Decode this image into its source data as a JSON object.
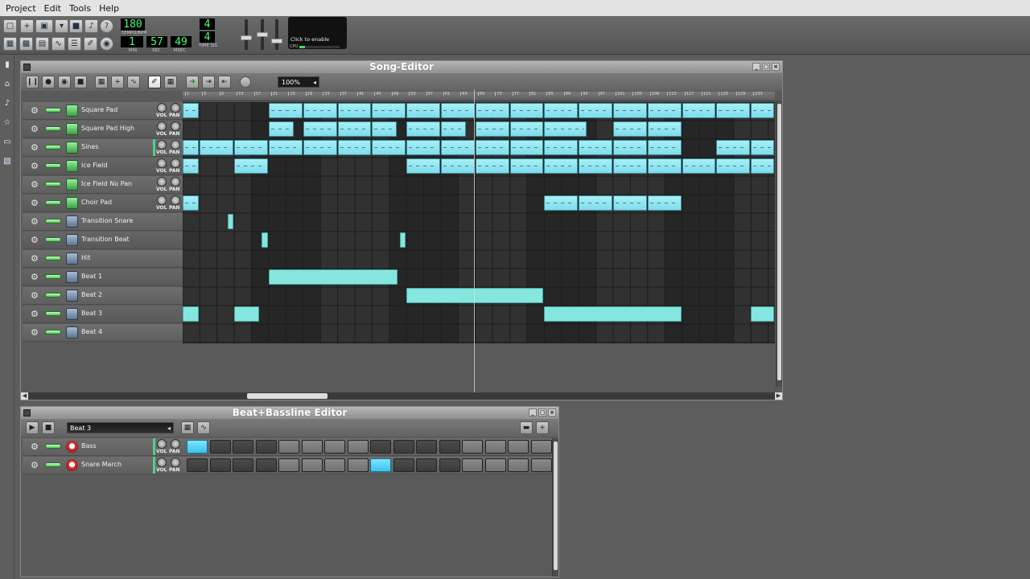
{
  "menu": [
    "Project",
    "Edit",
    "Tools",
    "Help"
  ],
  "transport": {
    "tempo": "180",
    "tempo_label": "TEMPO/BPM",
    "time_min": "1",
    "time_sec": "57",
    "time_msec": "49",
    "min_label": "MIN",
    "sec_label": "SEC",
    "msec_label": "MSEC",
    "timesig_num": "4",
    "timesig_den": "4",
    "timesig_label": "TIME SIG"
  },
  "cpu": {
    "hint": "Click to enable",
    "label": "CPU",
    "usage": 0.14
  },
  "song_editor": {
    "title": "Song-Editor",
    "zoom": "100%",
    "ruler": [
      "1",
      "5",
      "9",
      "13",
      "17",
      "21",
      "25",
      "29",
      "33",
      "37",
      "41",
      "45",
      "49",
      "53",
      "57",
      "61",
      "65",
      "69",
      "73",
      "77",
      "81",
      "85",
      "89",
      "93",
      "97",
      "101",
      "105",
      "109",
      "113",
      "117",
      "121",
      "125",
      "129",
      "133"
    ],
    "tracks": [
      {
        "name": "Square Pad",
        "type": "synth"
      },
      {
        "name": "Square Pad High",
        "type": "synth"
      },
      {
        "name": "Sines",
        "type": "synth"
      },
      {
        "name": "Ice Field",
        "type": "synth"
      },
      {
        "name": "Ice Field No Pan",
        "type": "synth"
      },
      {
        "name": "Choir Pad",
        "type": "synth"
      },
      {
        "name": "Transition Snare",
        "type": "bb"
      },
      {
        "name": "Transition Beat",
        "type": "bb"
      },
      {
        "name": "Hit",
        "type": "bb"
      },
      {
        "name": "Beat 1",
        "type": "bb"
      },
      {
        "name": "Beat 2",
        "type": "bb"
      },
      {
        "name": "Beat 3",
        "type": "bb"
      },
      {
        "name": "Beat 4",
        "type": "bb"
      }
    ],
    "knob_vol": "VOL",
    "knob_pan": "PAN"
  },
  "bb_editor": {
    "title": "Beat+Bassline Editor",
    "selected_beat": "Beat 3",
    "tracks": [
      {
        "name": "Bass",
        "steps_on": [
          0
        ]
      },
      {
        "name": "Snare March",
        "steps_on": [
          8
        ]
      }
    ]
  }
}
